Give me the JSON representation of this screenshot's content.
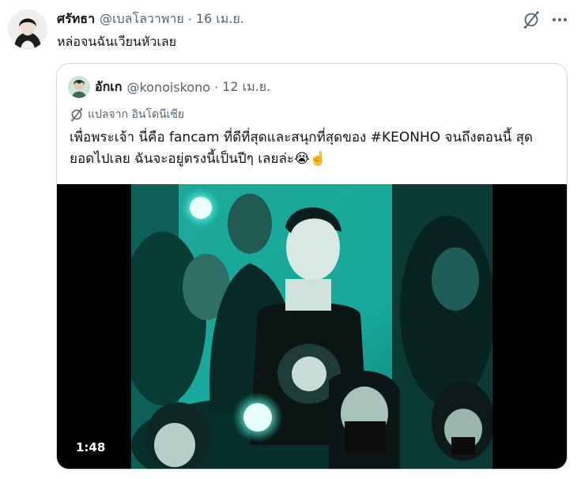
{
  "tweet": {
    "display_name": "ศรัทธา",
    "handle": "@เบลโลวาพาย",
    "separator": "·",
    "date": "16 เม.ย.",
    "text": "หล่อจนฉันเวียนหัวเลย",
    "avatar_icon": "profile-photo",
    "translate_icon": "translate-icon",
    "more_icon": "more-options-icon"
  },
  "quote": {
    "display_name": "อักเก",
    "handle": "@konoiskono",
    "separator": "·",
    "date": "12 เม.ย.",
    "translated_label": "แปลจาก อินโดนีเซีย",
    "text_line1": "เพื่อพระเจ้า นี่คือ fancam ที่ดีที่สุดและสนุกที่สุดของ #KEONHO จนถึงตอนนี้ สุด",
    "text_line2": "ยอดไปเลย ฉันจะอยู่ตรงนี้เป็นปีๆ เลยล่ะ",
    "emoji_1": "😭",
    "emoji_2": "☝️",
    "media": {
      "type": "video",
      "duration": "1:48",
      "accent_color": "#12c6b4"
    }
  },
  "colors": {
    "text_primary": "#0f1419",
    "text_secondary": "#536471",
    "border": "#cfd9de"
  }
}
